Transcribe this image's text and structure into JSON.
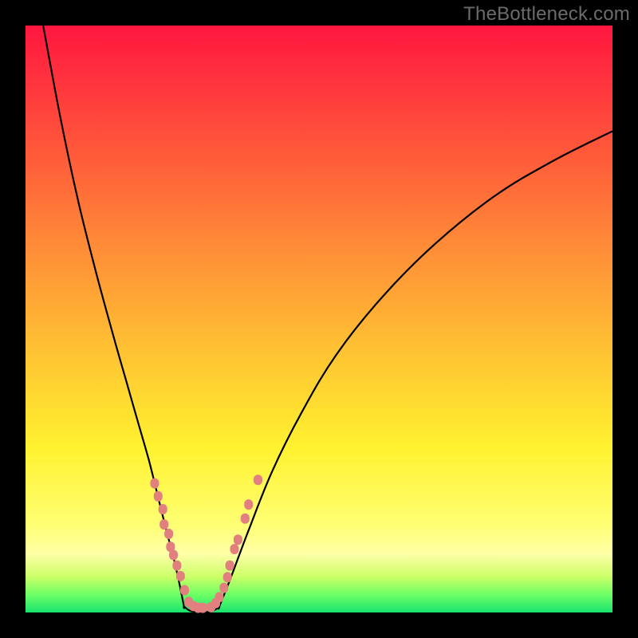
{
  "watermark": "TheBottleneck.com",
  "chart_data": {
    "type": "line",
    "title": "",
    "xlabel": "",
    "ylabel": "",
    "xlim": [
      0,
      100
    ],
    "ylim": [
      0,
      100
    ],
    "gradient_bands": [
      {
        "name": "red",
        "from": 0,
        "to": 20
      },
      {
        "name": "orange",
        "from": 20,
        "to": 55
      },
      {
        "name": "yellow",
        "from": 55,
        "to": 90
      },
      {
        "name": "green",
        "from": 90,
        "to": 100
      }
    ],
    "series": [
      {
        "name": "left-branch",
        "x": [
          3,
          6,
          9,
          12,
          15,
          17,
          19,
          21,
          22.5,
          24,
          25.3,
          26.3,
          27
        ],
        "values": [
          100,
          84,
          70,
          58,
          47,
          40,
          33,
          26,
          20,
          14,
          9,
          4.5,
          1
        ]
      },
      {
        "name": "valley-floor",
        "x": [
          27,
          28,
          29,
          30,
          31,
          32,
          33
        ],
        "values": [
          1,
          0.3,
          0.1,
          0.05,
          0.1,
          0.3,
          1
        ]
      },
      {
        "name": "right-branch",
        "x": [
          33,
          35,
          38,
          42,
          47,
          53,
          61,
          70,
          80,
          90,
          100
        ],
        "values": [
          1,
          6,
          14,
          24,
          34,
          44,
          54,
          63,
          71,
          77,
          82
        ]
      }
    ],
    "points": {
      "name": "highlight-dots",
      "x": [
        22.0,
        22.6,
        23.4,
        23.6,
        24.4,
        24.7,
        25.2,
        25.8,
        26.4,
        27.1,
        27.8,
        28.6,
        29.4,
        30.2,
        31.6,
        32.4,
        33.0,
        33.8,
        34.4,
        34.8,
        35.6,
        36.2,
        37.4,
        38.0,
        39.6
      ],
      "values": [
        22.0,
        19.8,
        17.6,
        15.0,
        13.4,
        11.2,
        9.8,
        8.0,
        6.2,
        3.8,
        1.8,
        1.1,
        0.8,
        0.8,
        0.9,
        1.6,
        2.6,
        4.2,
        6.0,
        8.0,
        10.8,
        12.4,
        16.0,
        18.4,
        22.6
      ]
    }
  }
}
